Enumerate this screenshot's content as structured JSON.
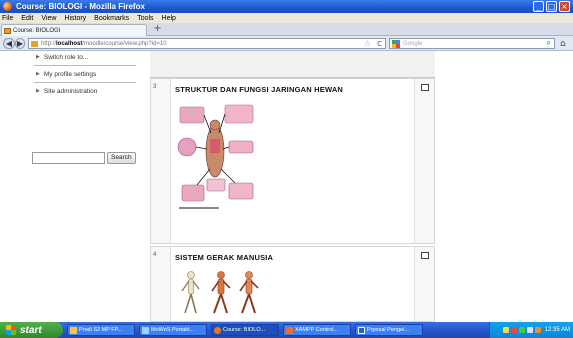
{
  "window": {
    "title": "Course: BIOLOGI - Mozilla Firefox",
    "buttons": [
      "_",
      "□",
      "×"
    ]
  },
  "menubar": {
    "items": [
      "File",
      "Edit",
      "View",
      "History",
      "Bookmarks",
      "Tools",
      "Help"
    ]
  },
  "tabs": {
    "active": "Course: BIOLOGI",
    "new_tab": "+"
  },
  "navbar": {
    "back": "◀",
    "forward": "▶",
    "url_prefix": "http://",
    "url_host": "localhost",
    "url_path": "/moodle/course/view.php?id=10",
    "star": "☆",
    "reload": "C",
    "search_placeholder": "Google",
    "search_icon": "magnifier-icon",
    "home_icon": "home-icon"
  },
  "sidebar": {
    "items": [
      {
        "label": "Switch role to..."
      },
      {
        "label": "My profile settings"
      },
      {
        "label": "Site administration"
      }
    ],
    "search_button": "Search"
  },
  "sections": [
    {
      "number": "3",
      "title": "STRUKTUR DAN FUNGSI JARINGAN HEWAN"
    },
    {
      "number": "4",
      "title": "SISTEM GERAK MANUSIA"
    }
  ],
  "taskbar": {
    "start": "start",
    "buttons": [
      "Prodi S2 MP FP...",
      "MoWeS Portabl...",
      "Course: BIOLO...",
      "XAMPP Control...",
      "Prposal Pengel..."
    ],
    "clock": "12:35 AM"
  },
  "colors": {
    "titlebar": "#1c58d0",
    "taskbar": "#2457cd",
    "start": "#2f8a2a"
  }
}
